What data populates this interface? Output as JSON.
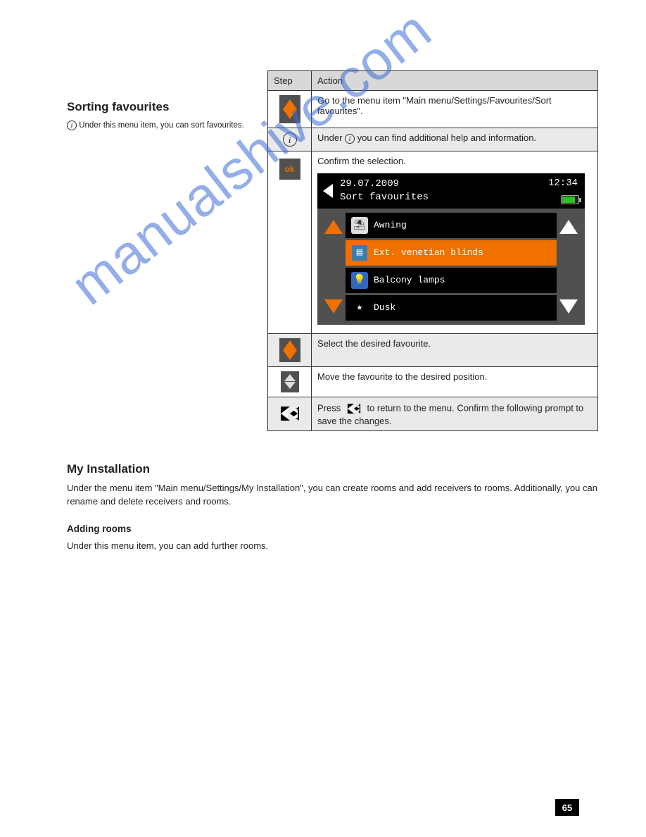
{
  "section1": {
    "heading": "Sorting favourites",
    "hint_prefix": "",
    "hint": "Under this menu item, you can sort favourites."
  },
  "table_header": {
    "col1": "Step",
    "col2": "Action"
  },
  "steps": [
    {
      "icon": "updown",
      "text": "Go to the menu item \"Main menu/Settings/Favourites/Sort favourites\"."
    },
    {
      "icon": "info",
      "text": "Under   you can find additional help and information."
    },
    {
      "icon": "ok",
      "text": "Confirm the selection.",
      "has_screen": true
    },
    {
      "icon": "updown",
      "text": "Select the desired favourite."
    },
    {
      "icon": "greyud",
      "text": "Move the favourite to the desired position."
    },
    {
      "icon": "back",
      "text": "Press   to return to the menu. Confirm the following prompt to save the changes."
    }
  ],
  "screen": {
    "date": "29.07.2009",
    "time": "12:34",
    "title": "Sort favourites",
    "items": [
      {
        "icon": "awn",
        "label": "Awning",
        "selected": false
      },
      {
        "icon": "blind",
        "label": "Ext. venetian blinds",
        "selected": true
      },
      {
        "icon": "lamp",
        "label": "Balcony lamps",
        "selected": false
      },
      {
        "icon": "star",
        "label": "Dusk",
        "selected": false
      }
    ]
  },
  "section2": {
    "heading": "My Installation",
    "intro": "Under the menu item \"Main menu/Settings/My Installation\", you can create rooms and add receivers to rooms. Additionally, you can rename and delete receivers and rooms."
  },
  "sub": {
    "title": "Adding rooms",
    "text": "Under this menu item, you can add further rooms."
  },
  "watermark": "manualshive.com",
  "page_number": "65"
}
